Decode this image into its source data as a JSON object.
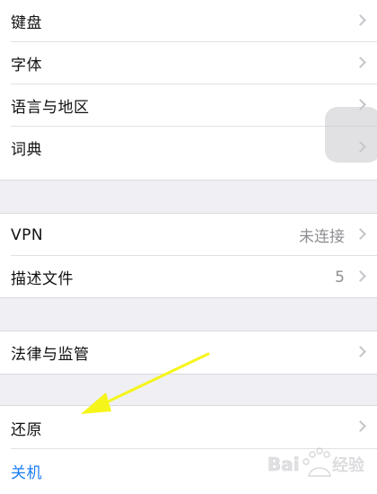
{
  "settings": {
    "group1": [
      {
        "label": "键盘"
      },
      {
        "label": "字体"
      },
      {
        "label": "语言与地区"
      },
      {
        "label": "词典"
      }
    ],
    "group2": [
      {
        "label": "VPN",
        "value": "未连接"
      },
      {
        "label": "描述文件",
        "value": "5"
      }
    ],
    "group3": [
      {
        "label": "法律与监管"
      }
    ],
    "group4": [
      {
        "label": "还原"
      },
      {
        "label": "关机"
      }
    ]
  },
  "colors": {
    "background": "#efeff4",
    "cell": "#ffffff",
    "link": "#1a7cf4",
    "secondary_text": "#8e8e93",
    "annotation_arrow": "#f5f51a"
  },
  "icons": {
    "chevron": "chevron-right-icon",
    "assistive_touch": "assistive-touch-icon",
    "annotation": "yellow-arrow-annotation",
    "watermark": "baidu-jingyan-watermark"
  },
  "watermark": {
    "text": "Bai du 经验"
  }
}
